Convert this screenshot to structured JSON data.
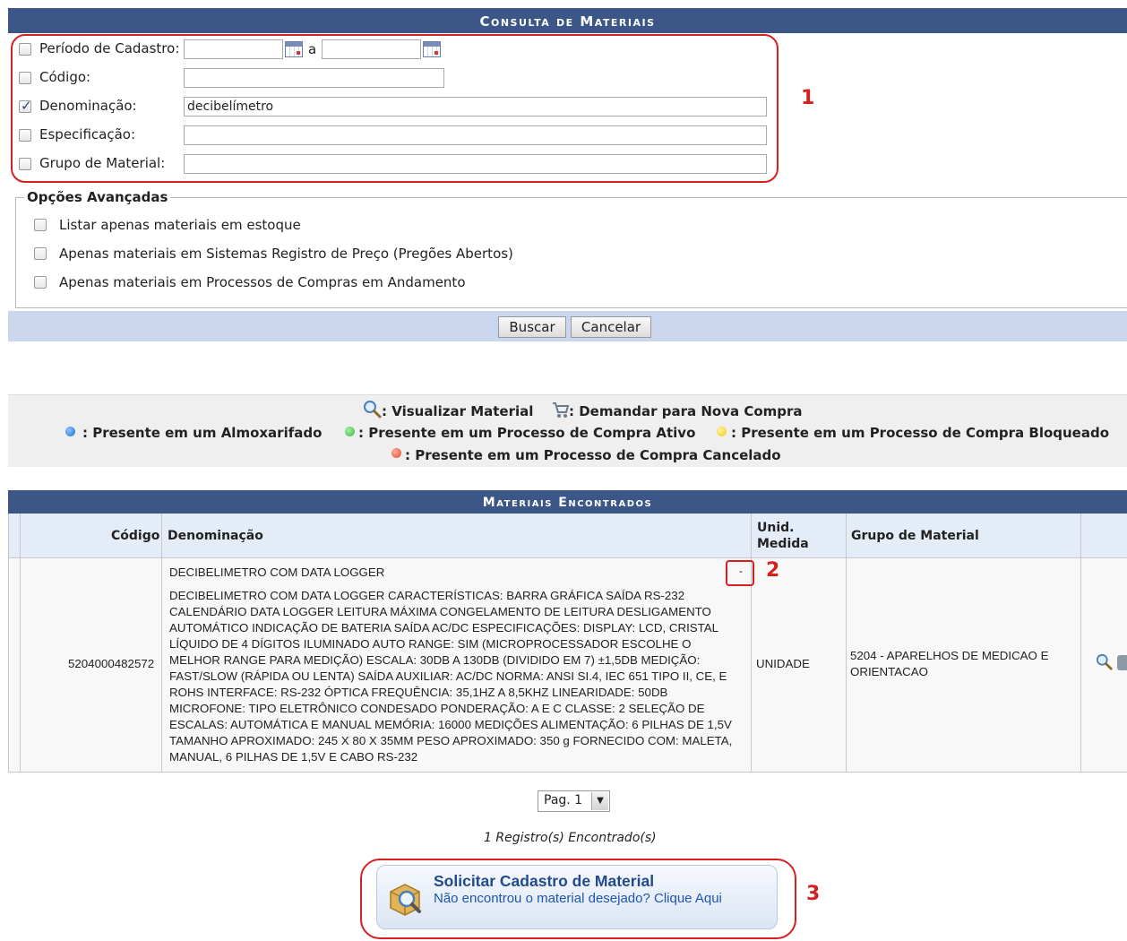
{
  "search": {
    "title": "Consulta de Materiais",
    "fields": {
      "periodo_label": "Período de Cadastro:",
      "periodo_sep": "a",
      "periodo_start": "",
      "periodo_end": "",
      "codigo_label": "Código:",
      "codigo_value": "",
      "denominacao_label": "Denominação:",
      "denominacao_value": "decibelímetro",
      "especificacao_label": "Especificação:",
      "especificacao_value": "",
      "grupo_label": "Grupo de Material:",
      "grupo_value": ""
    },
    "checks": {
      "periodo": false,
      "codigo": false,
      "denominacao": true,
      "especificacao": false,
      "grupo": false
    },
    "advanced": {
      "legend": "Opções Avançadas",
      "options": [
        {
          "label": "Listar apenas materiais em estoque",
          "checked": false
        },
        {
          "label": "Apenas materiais em Sistemas Registro de Preço (Pregões Abertos)",
          "checked": false
        },
        {
          "label": "Apenas materiais em Processos de Compras em Andamento",
          "checked": false
        }
      ]
    },
    "buttons": {
      "search": "Buscar",
      "cancel": "Cancelar"
    }
  },
  "legend": {
    "view": ": Visualizar Material",
    "demand": ": Demandar para Nova Compra",
    "blue": ": Presente em um Almoxarifado",
    "green": ": Presente em um Processo de Compra Ativo",
    "yellow": ": Presente em um Processo de Compra Bloqueado",
    "red": ": Presente em um Processo de Compra Cancelado",
    "colors": {
      "blue": "#1e6fd6",
      "green": "#3cb53c",
      "yellow": "#f2c811",
      "red": "#e2452a"
    }
  },
  "results": {
    "title": "Materiais Encontrados",
    "headers": {
      "codigo": "Código",
      "denominacao": "Denominação",
      "unid_line1": "Unid.",
      "unid_line2": "Medida",
      "grupo": "Grupo de Material"
    },
    "row": {
      "codigo": "5204000482572",
      "name": "DECIBELIMETRO COM DATA LOGGER",
      "toggle": "-",
      "description": "DECIBELIMETRO COM DATA LOGGER CARACTERÍSTICAS: BARRA GRÁFICA SAÍDA RS-232 CALENDÁRIO DATA LOGGER LEITURA MÁXIMA CONGELAMENTO DE LEITURA DESLIGAMENTO AUTOMÁTICO INDICAÇÃO DE BATERIA SAÍDA AC/DC ESPECIFICAÇÕES: DISPLAY: LCD, CRISTAL LÍQUIDO DE 4 DÍGITOS ILUMINADO AUTO RANGE: SIM (MICROPROCESSADOR ESCOLHE O MELHOR RANGE PARA MEDIÇÃO) ESCALA: 30DB A 130DB (DIVIDIDO EM 7) ±1,5DB MEDIÇÃO: FAST/SLOW (RÁPIDA OU LENTA) SAÍDA AUXILIAR: AC/DC NORMA: ANSI SI.4, IEC 651 TIPO II, CE, E ROHS INTERFACE: RS-232 ÓPTICA FREQUÊNCIA: 35,1HZ A 8,5KHZ LINEARIDADE: 50DB MICROFONE: TIPO ELETRÔNICO CONDESADO PONDERAÇÃO: A E C CLASSE: 2 SELEÇÃO DE ESCALAS: AUTOMÁTICA E MANUAL MEMÓRIA: 16000 MEDIÇÕES ALIMENTAÇÃO: 6 PILHAS DE 1,5V TAMANHO APROXIMADO: 245 X 80 X 35MM PESO APROXIMADO: 350 g FORNECIDO COM: MALETA, MANUAL, 6 PILHAS DE 1,5V E CABO RS-232",
      "unidade": "UNIDADE",
      "grupo": "5204 - APARELHOS DE MEDICAO E ORIENTACAO"
    },
    "pager": "Pag. 1",
    "count": "1 Registro(s) Encontrado(s)"
  },
  "request": {
    "title": "Solicitar Cadastro de Material",
    "subtitle": "Não encontrou o material desejado? Clique Aqui"
  },
  "annotations": {
    "one": "1",
    "two": "2",
    "three": "3"
  }
}
